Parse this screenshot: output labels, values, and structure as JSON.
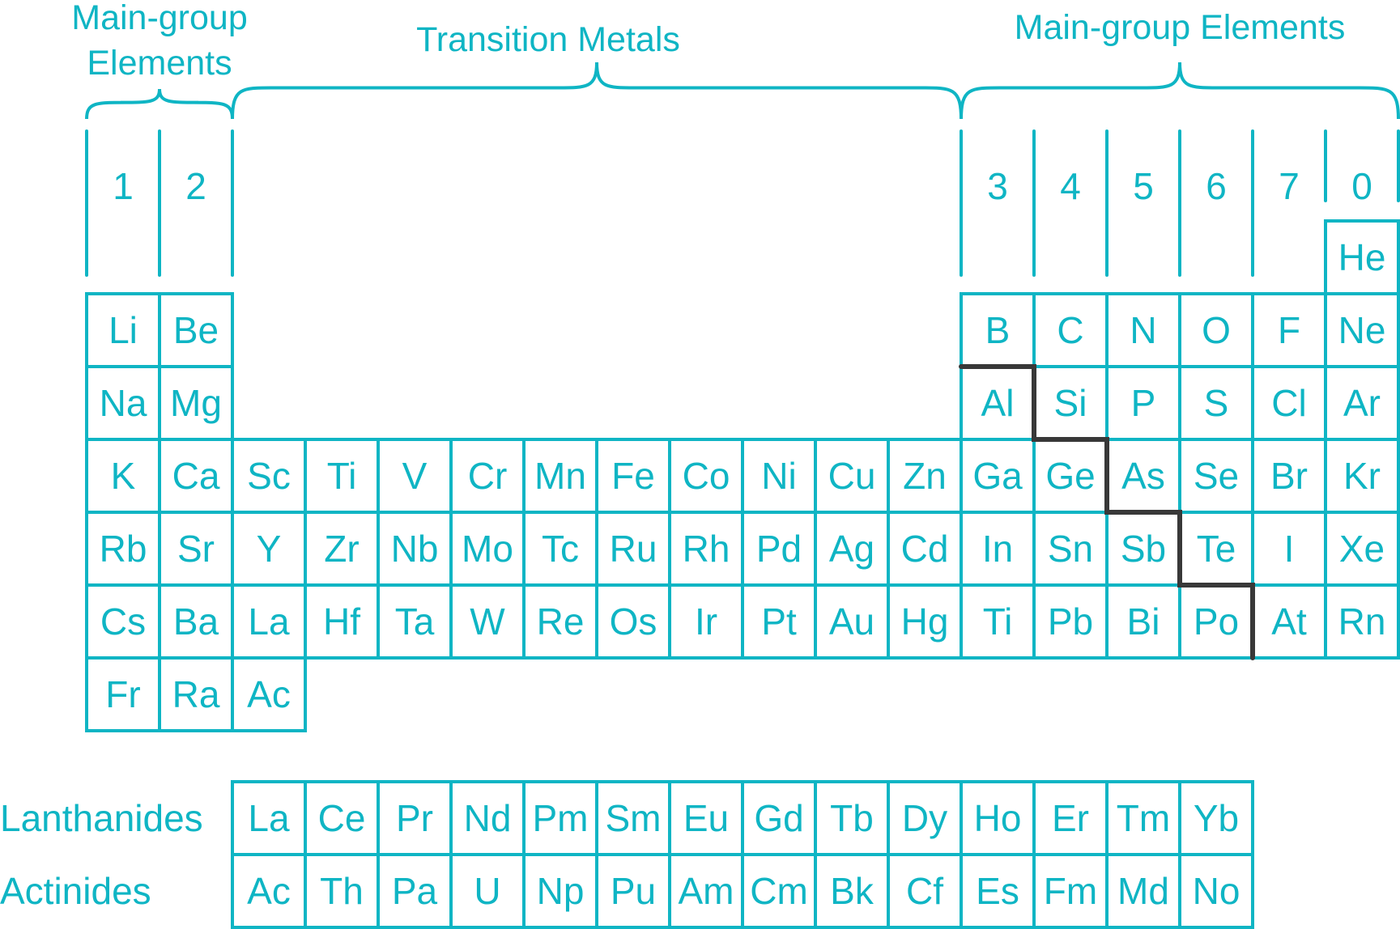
{
  "colors": {
    "accent": "#0fb5c4",
    "boundary": "#383838",
    "background": "#ffffff"
  },
  "headings": {
    "left_main_group": [
      "Main-group",
      "Elements"
    ],
    "transition": "Transition Metals",
    "right_main_group": "Main-group Elements"
  },
  "group_numbers": [
    {
      "label": "1",
      "col": 1
    },
    {
      "label": "2",
      "col": 2
    },
    {
      "label": "3",
      "col": 13
    },
    {
      "label": "4",
      "col": 14
    },
    {
      "label": "5",
      "col": 15
    },
    {
      "label": "6",
      "col": 16
    },
    {
      "label": "7",
      "col": 17
    },
    {
      "label": "0",
      "col": 18
    }
  ],
  "main_table": [
    {
      "period": 1,
      "cells": [
        {
          "col": 18,
          "symbol": "He"
        }
      ]
    },
    {
      "period": 2,
      "cells": [
        {
          "col": 1,
          "symbol": "Li"
        },
        {
          "col": 2,
          "symbol": "Be"
        },
        {
          "col": 13,
          "symbol": "B"
        },
        {
          "col": 14,
          "symbol": "C"
        },
        {
          "col": 15,
          "symbol": "N"
        },
        {
          "col": 16,
          "symbol": "O"
        },
        {
          "col": 17,
          "symbol": "F"
        },
        {
          "col": 18,
          "symbol": "Ne"
        }
      ]
    },
    {
      "period": 3,
      "cells": [
        {
          "col": 1,
          "symbol": "Na"
        },
        {
          "col": 2,
          "symbol": "Mg"
        },
        {
          "col": 13,
          "symbol": "Al"
        },
        {
          "col": 14,
          "symbol": "Si"
        },
        {
          "col": 15,
          "symbol": "P"
        },
        {
          "col": 16,
          "symbol": "S"
        },
        {
          "col": 17,
          "symbol": "Cl"
        },
        {
          "col": 18,
          "symbol": "Ar"
        }
      ]
    },
    {
      "period": 4,
      "cells": [
        {
          "col": 1,
          "symbol": "K"
        },
        {
          "col": 2,
          "symbol": "Ca"
        },
        {
          "col": 3,
          "symbol": "Sc"
        },
        {
          "col": 4,
          "symbol": "Ti"
        },
        {
          "col": 5,
          "symbol": "V"
        },
        {
          "col": 6,
          "symbol": "Cr"
        },
        {
          "col": 7,
          "symbol": "Mn"
        },
        {
          "col": 8,
          "symbol": "Fe"
        },
        {
          "col": 9,
          "symbol": "Co"
        },
        {
          "col": 10,
          "symbol": "Ni"
        },
        {
          "col": 11,
          "symbol": "Cu"
        },
        {
          "col": 12,
          "symbol": "Zn"
        },
        {
          "col": 13,
          "symbol": "Ga"
        },
        {
          "col": 14,
          "symbol": "Ge"
        },
        {
          "col": 15,
          "symbol": "As"
        },
        {
          "col": 16,
          "symbol": "Se"
        },
        {
          "col": 17,
          "symbol": "Br"
        },
        {
          "col": 18,
          "symbol": "Kr"
        }
      ]
    },
    {
      "period": 5,
      "cells": [
        {
          "col": 1,
          "symbol": "Rb"
        },
        {
          "col": 2,
          "symbol": "Sr"
        },
        {
          "col": 3,
          "symbol": "Y"
        },
        {
          "col": 4,
          "symbol": "Zr"
        },
        {
          "col": 5,
          "symbol": "Nb"
        },
        {
          "col": 6,
          "symbol": "Mo"
        },
        {
          "col": 7,
          "symbol": "Tc"
        },
        {
          "col": 8,
          "symbol": "Ru"
        },
        {
          "col": 9,
          "symbol": "Rh"
        },
        {
          "col": 10,
          "symbol": "Pd"
        },
        {
          "col": 11,
          "symbol": "Ag"
        },
        {
          "col": 12,
          "symbol": "Cd"
        },
        {
          "col": 13,
          "symbol": "In"
        },
        {
          "col": 14,
          "symbol": "Sn"
        },
        {
          "col": 15,
          "symbol": "Sb"
        },
        {
          "col": 16,
          "symbol": "Te"
        },
        {
          "col": 17,
          "symbol": "I"
        },
        {
          "col": 18,
          "symbol": "Xe"
        }
      ]
    },
    {
      "period": 6,
      "cells": [
        {
          "col": 1,
          "symbol": "Cs"
        },
        {
          "col": 2,
          "symbol": "Ba"
        },
        {
          "col": 3,
          "symbol": "La"
        },
        {
          "col": 4,
          "symbol": "Hf"
        },
        {
          "col": 5,
          "symbol": "Ta"
        },
        {
          "col": 6,
          "symbol": "W"
        },
        {
          "col": 7,
          "symbol": "Re"
        },
        {
          "col": 8,
          "symbol": "Os"
        },
        {
          "col": 9,
          "symbol": "Ir"
        },
        {
          "col": 10,
          "symbol": "Pt"
        },
        {
          "col": 11,
          "symbol": "Au"
        },
        {
          "col": 12,
          "symbol": "Hg"
        },
        {
          "col": 13,
          "symbol": "Ti"
        },
        {
          "col": 14,
          "symbol": "Pb"
        },
        {
          "col": 15,
          "symbol": "Bi"
        },
        {
          "col": 16,
          "symbol": "Po"
        },
        {
          "col": 17,
          "symbol": "At"
        },
        {
          "col": 18,
          "symbol": "Rn"
        }
      ]
    },
    {
      "period": 7,
      "cells": [
        {
          "col": 1,
          "symbol": "Fr"
        },
        {
          "col": 2,
          "symbol": "Ra"
        },
        {
          "col": 3,
          "symbol": "Ac"
        }
      ]
    }
  ],
  "f_block": [
    {
      "label": "Lanthanides",
      "symbols": [
        "La",
        "Ce",
        "Pr",
        "Nd",
        "Pm",
        "Sm",
        "Eu",
        "Gd",
        "Tb",
        "Dy",
        "Ho",
        "Er",
        "Tm",
        "Yb"
      ]
    },
    {
      "label": "Actinides",
      "symbols": [
        "Ac",
        "Th",
        "Pa",
        "U",
        "Np",
        "Pu",
        "Am",
        "Cm",
        "Bk",
        "Cf",
        "Es",
        "Fm",
        "Md",
        "No"
      ]
    }
  ],
  "metal_nonmetal_boundary": {
    "description": "staircase line between metals and non-metals",
    "steps": [
      {
        "period": 2,
        "col": 13
      },
      {
        "period": 3,
        "col": 14
      },
      {
        "period": 4,
        "col": 15
      },
      {
        "period": 5,
        "col": 16
      }
    ]
  }
}
